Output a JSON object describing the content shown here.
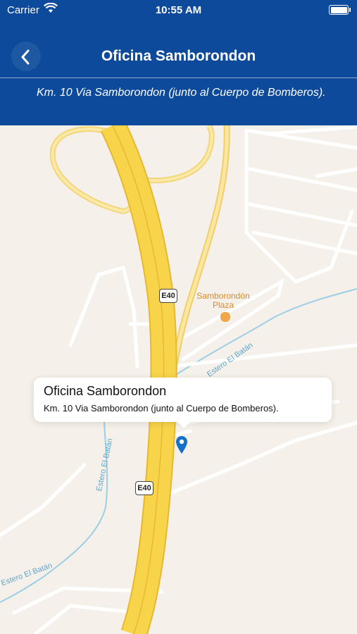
{
  "status_bar": {
    "carrier": "Carrier",
    "time": "10:55 AM"
  },
  "nav": {
    "title": "Oficina Samborondon",
    "back_icon": "chevron-left-icon"
  },
  "location": {
    "address": "Km. 10 Via Samborondon (junto al Cuerpo de Bomberos)."
  },
  "map": {
    "shields": [
      "E40",
      "E40"
    ],
    "poi": {
      "name_line1": "Samborondón",
      "name_line2": "Plaza"
    },
    "streets": [
      "Estero El Batán",
      "Estero El Batán",
      "Estero El Batán"
    ],
    "callout": {
      "title": "Oficina Samborondon",
      "subtitle": "Km. 10 Via Samborondon (junto al Cuerpo de Bomberos)."
    },
    "colors": {
      "highway": "#f8d44a",
      "highway_edge": "#e6b830",
      "water": "#9ecde6",
      "land": "#f5f1ea",
      "pin": "#1670c7",
      "header": "#0d4a9b"
    }
  }
}
